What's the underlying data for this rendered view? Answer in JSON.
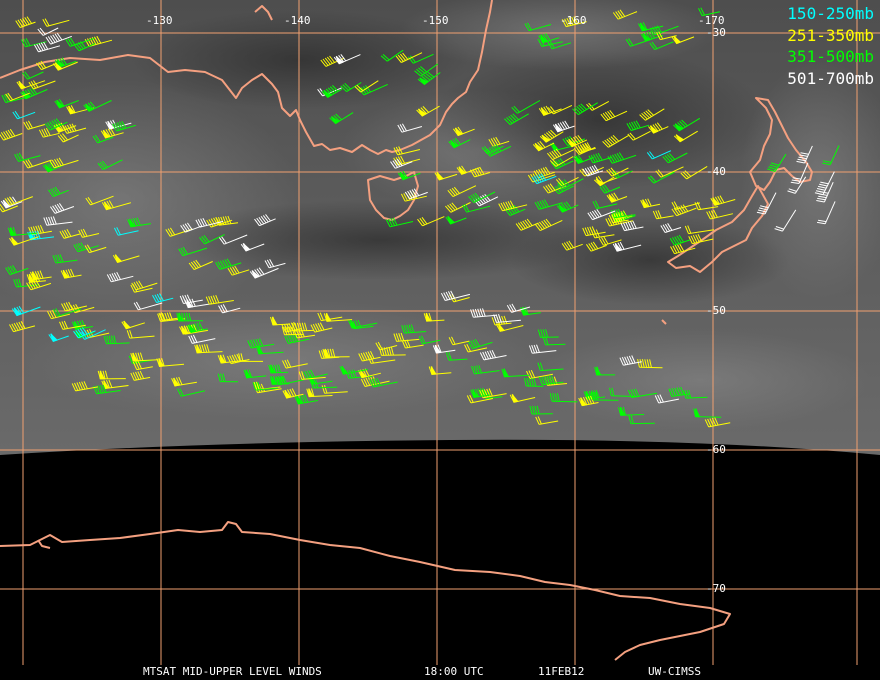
{
  "map": {
    "longitude_labels": [
      "-130",
      "-140",
      "-150",
      "-160",
      "-170"
    ],
    "latitude_labels": [
      "-30",
      "-40",
      "-50",
      "-60",
      "-70"
    ],
    "colors": {
      "grid": "#f0a070",
      "coastline": "#f4a080",
      "background_night": "#000000",
      "cloud_gray": "#5a5a5a"
    }
  },
  "legend": [
    {
      "label": "150-250mb",
      "color": "#00ffff"
    },
    {
      "label": "251-350mb",
      "color": "#ffff00"
    },
    {
      "label": "351-500mb",
      "color": "#00ff00"
    },
    {
      "label": "501-700mb",
      "color": "#ffffff"
    }
  ],
  "footer": {
    "product": "MTSAT MID-UPPER LEVEL WINDS",
    "time": "18:00 UTC",
    "date": "11FEB12",
    "source": "UW-CIMSS"
  }
}
